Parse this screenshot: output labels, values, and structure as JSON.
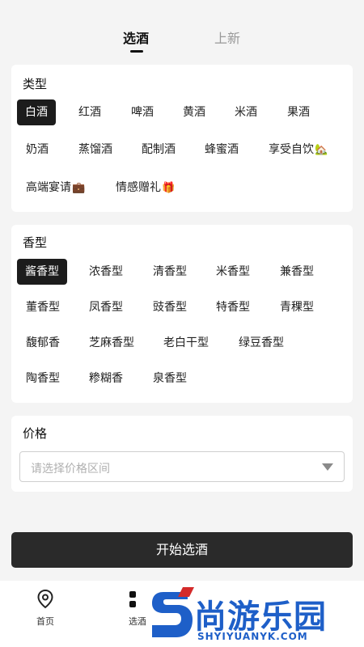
{
  "tabs": {
    "active": "选酒",
    "inactive": "上新"
  },
  "type_section": {
    "title": "类型",
    "chips": [
      "白酒",
      "红酒",
      "啤酒",
      "黄酒",
      "米酒",
      "果酒",
      "奶酒",
      "蒸馏酒",
      "配制酒",
      "蜂蜜酒",
      "享受自饮",
      "高端宴请",
      "情感赠礼"
    ],
    "selected": "白酒",
    "emojis": {
      "享受自饮": "🏡",
      "高端宴请": "💼",
      "情感赠礼": "🎁"
    }
  },
  "aroma_section": {
    "title": "香型",
    "chips": [
      "酱香型",
      "浓香型",
      "清香型",
      "米香型",
      "兼香型",
      "董香型",
      "凤香型",
      "豉香型",
      "特香型",
      "青稞型",
      "馥郁香",
      "芝麻香型",
      "老白干型",
      "绿豆香型",
      "陶香型",
      "糁糊香",
      "泉香型"
    ],
    "selected": "酱香型"
  },
  "price_section": {
    "title": "价格",
    "placeholder": "请选择价格区间"
  },
  "start_button": "开始选酒",
  "bottom_nav": [
    {
      "label": "首页",
      "icon": "location-pin-icon"
    },
    {
      "label": "选酒",
      "icon": "grid-icon"
    }
  ],
  "watermark": {
    "text": "尚游乐园",
    "sub": "SHYIYUANYK.COM"
  },
  "colors": {
    "selected_chip": "#1c1c1c",
    "button": "#2a2a2a",
    "watermark": "#1e5fc8"
  }
}
